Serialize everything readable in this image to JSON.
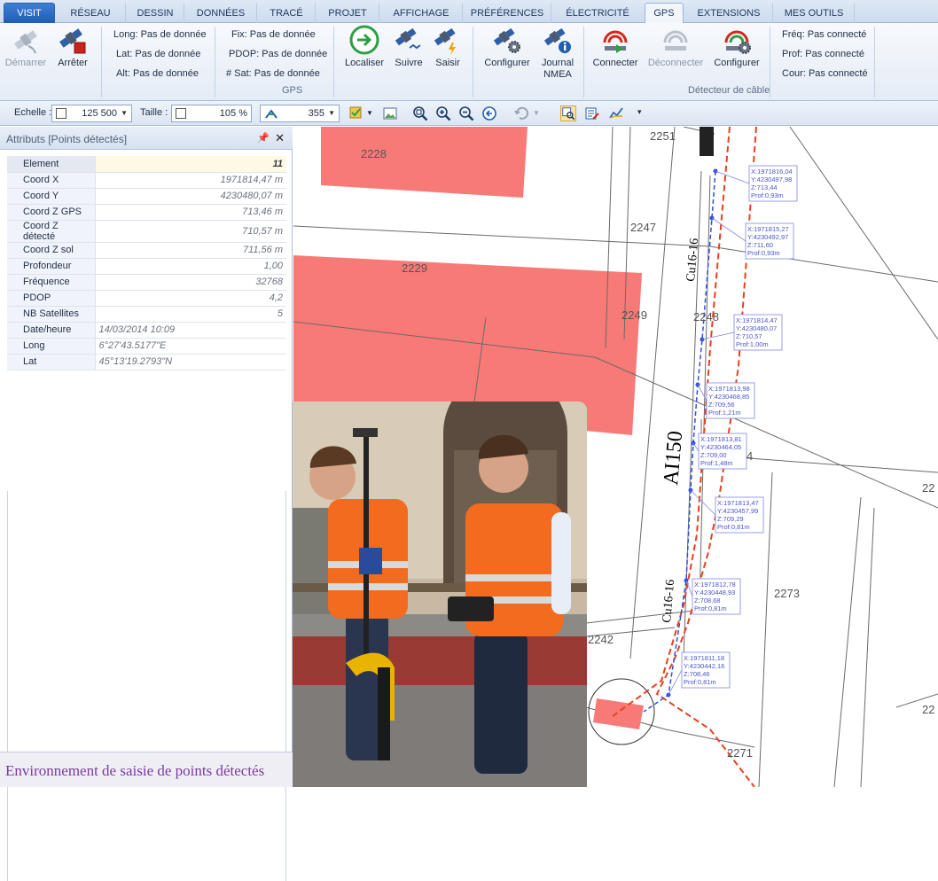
{
  "ribbon_tabs": [
    "VISIT",
    "RÉSEAU",
    "DESSIN",
    "DONNÉES",
    "TRACÉ",
    "PROJET",
    "AFFICHAGE",
    "PRÉFÉRENCES",
    "ÉLECTRICITÉ",
    "GPS",
    "EXTENSIONS",
    "MES OUTILS"
  ],
  "active_tab": "GPS",
  "gps_group": {
    "start_label": "Démarrer",
    "stop_label": "Arrêter",
    "long": "Long: Pas de donnée",
    "lat": "Lat: Pas de donnée",
    "alt": "Alt: Pas de donnée",
    "fix": "Fix: Pas de donnée",
    "pdop": "PDOP: Pas de donnée",
    "sat": "# Sat: Pas de donnée",
    "locate_label": "Localiser",
    "follow_label": "Suivre",
    "capture_label": "Saisir",
    "configure_label": "Configurer",
    "nmea_label_1": "Journal",
    "nmea_label_2": "NMEA",
    "group_label": "GPS"
  },
  "cable_group": {
    "connect_label": "Connecter",
    "disconnect_label": "Déconnecter",
    "configure_label": "Configurer",
    "freq": "Fréq: Pas connecté",
    "prof": "Prof: Pas connecté",
    "cour": "Cour: Pas connecté",
    "group_label": "Détecteur de câble"
  },
  "toolbar": {
    "scale_label": "Echelle :",
    "scale_value": "125 500",
    "size_label": "Taille :",
    "size_value": "105 %",
    "angle_value": "355"
  },
  "panel": {
    "title": "Attributs [Points détectés]",
    "pin_icon": "pin-icon",
    "close_icon": "close-icon",
    "rows": [
      {
        "key": "Element",
        "value": "11"
      },
      {
        "key": "Coord X",
        "value": "1971814,47 m"
      },
      {
        "key": "Coord Y",
        "value": "4230480,07 m"
      },
      {
        "key": "Coord Z GPS",
        "value": "713,46 m"
      },
      {
        "key": "Coord Z détecté",
        "value": "710,57 m"
      },
      {
        "key": "Coord Z sol",
        "value": "711,56 m"
      },
      {
        "key": "Profondeur",
        "value": "1,00"
      },
      {
        "key": "Fréquence",
        "value": "32768"
      },
      {
        "key": "PDOP",
        "value": "4,2"
      },
      {
        "key": "NB Satellites",
        "value": "5"
      },
      {
        "key": "Date/heure",
        "value": "14/03/2014 10:09"
      },
      {
        "key": "Long",
        "value": "6°27'43.5177\"E"
      },
      {
        "key": "Lat",
        "value": "45°13'19.2793\"N"
      }
    ]
  },
  "caption": "Environnement de saisie de points détectés",
  "map": {
    "parcels": [
      "2251",
      "2228",
      "2247",
      "2229",
      "2249",
      "2248",
      "4",
      "22",
      "2273",
      "22",
      "2242",
      "2271"
    ],
    "section_label": "AI150",
    "cable_label_1": "Cu16-16",
    "cable_label_2": "Cu16-16",
    "points": [
      {
        "x": "X:1971816,04",
        "y": "Y:4230497,98",
        "z": "Z:713,44",
        "p": "Prof:0,93m"
      },
      {
        "x": "X:1971815,27",
        "y": "Y:4230492,97",
        "z": "Z:711,60",
        "p": "Prof:0,93m"
      },
      {
        "x": "X:1971814,47",
        "y": "Y:4230480,07",
        "z": "Z:710,57",
        "p": "Prof:1,00m"
      },
      {
        "x": "X:1971813,98",
        "y": "Y:4230468,85",
        "z": "Z:709,56",
        "p": "Prof:1,21m"
      },
      {
        "x": "X:1971813,81",
        "y": "Y:4230464,05",
        "z": "Z:709,00",
        "p": "Prof:1,48m"
      },
      {
        "x": "X:1971813,47",
        "y": "Y:4230457,99",
        "z": "Z:709,29",
        "p": "Prof:0,81m"
      },
      {
        "x": "X:1971812,78",
        "y": "Y:4230448,93",
        "z": "Z:708,68",
        "p": "Prof:0,81m"
      },
      {
        "x": "X:1971811,18",
        "y": "Y:4230442,16",
        "z": "Z:708,46",
        "p": "Prof:0,81m"
      }
    ]
  },
  "colors": {
    "building": "#f87a77",
    "cable_red": "#e8401e",
    "cable_blue": "#3050e0",
    "label_border": "#8088e0"
  }
}
